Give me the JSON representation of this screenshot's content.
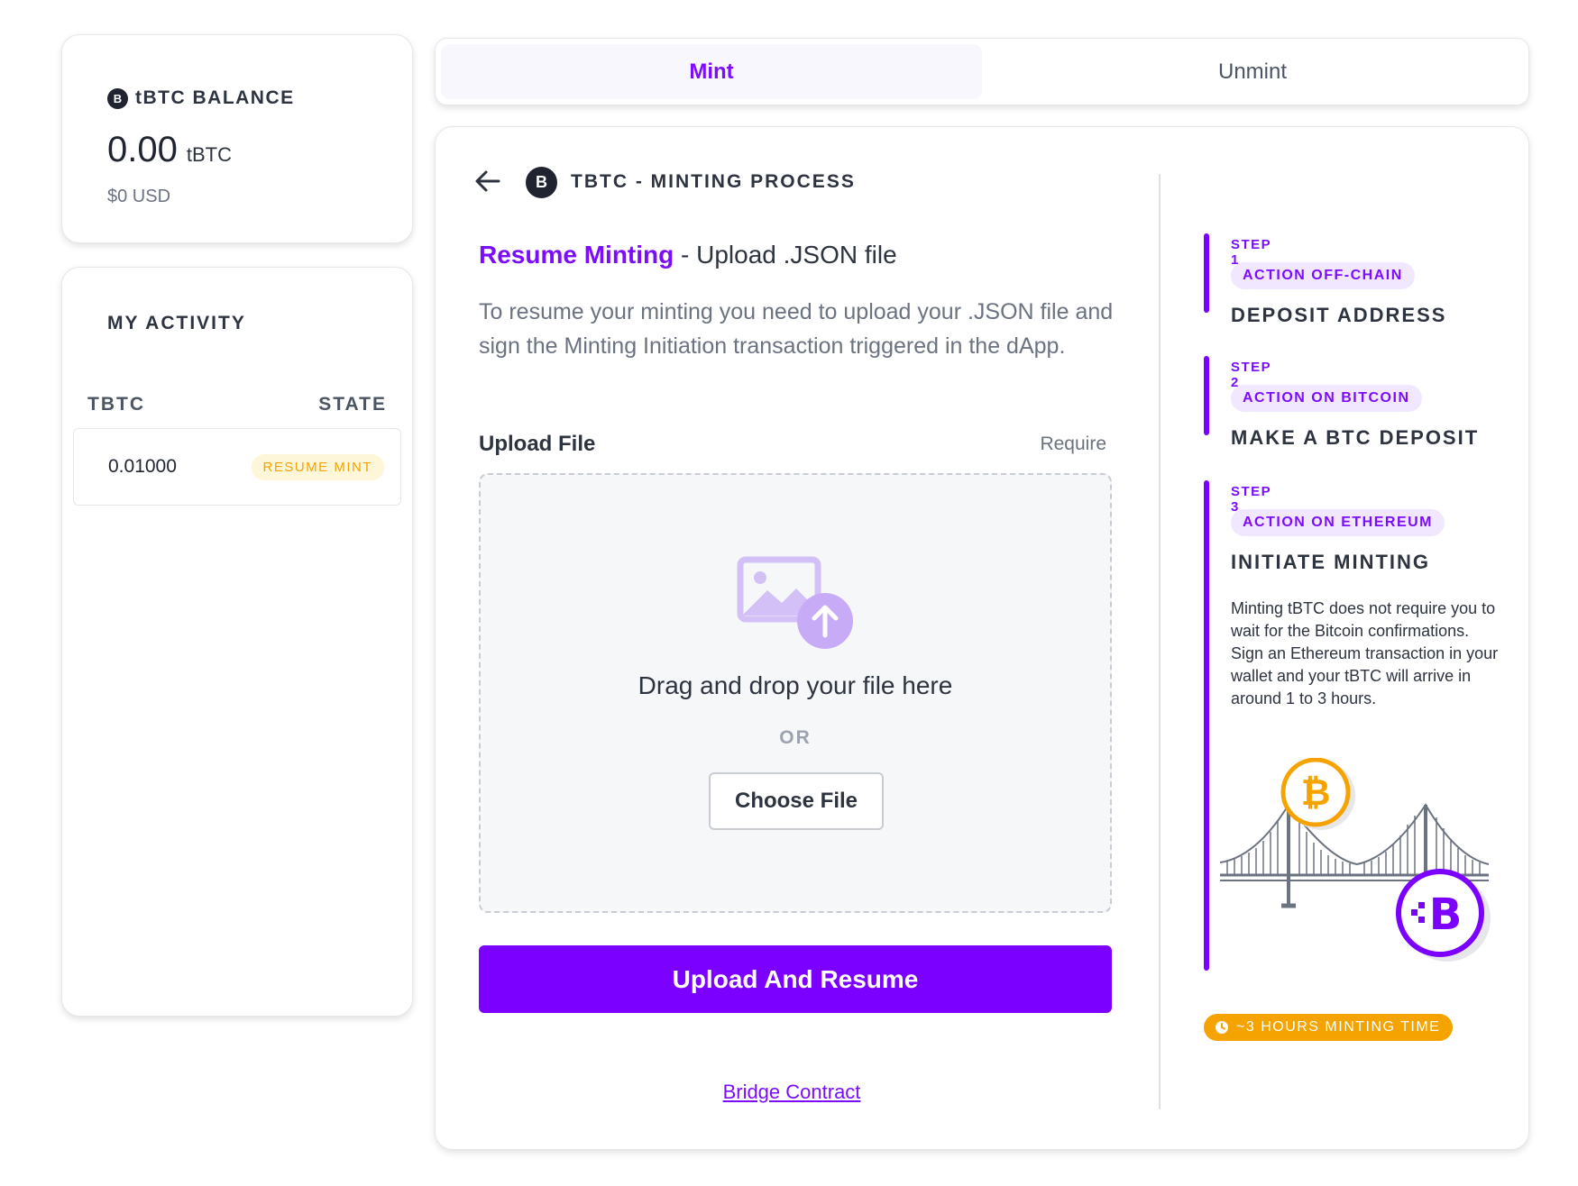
{
  "balance": {
    "title": "tBTC BALANCE",
    "amount": "0.00",
    "unit": "tBTC",
    "usd": "$0 USD",
    "logo_glyph": "B"
  },
  "activity": {
    "title": "MY ACTIVITY",
    "col_token": "TBTC",
    "col_state": "STATE",
    "rows": [
      {
        "amount": "0.01000",
        "state": "RESUME MINT"
      }
    ]
  },
  "tabs": [
    {
      "label": "Mint",
      "active": true
    },
    {
      "label": "Unmint",
      "active": false
    }
  ],
  "process": {
    "title": "TBTC - MINTING PROCESS",
    "logo_glyph": "B",
    "heading_accent": "Resume Minting",
    "heading_rest": " - Upload .JSON file",
    "description": "To resume your minting you need to upload your .JSON file and sign the Minting Initiation transaction triggered in the dApp.",
    "upload_label": "Upload File",
    "require_label": "Require",
    "drop_text": "Drag and drop your file here",
    "or_text": "OR",
    "choose_file": "Choose File",
    "submit": "Upload And Resume",
    "bridge_link": "Bridge Contract"
  },
  "steps": [
    {
      "label": "STEP 1",
      "pill": "ACTION OFF-CHAIN",
      "name": "DEPOSIT ADDRESS"
    },
    {
      "label": "STEP 2",
      "pill": "ACTION ON BITCOIN",
      "name": "MAKE A BTC DEPOSIT"
    },
    {
      "label": "STEP 3",
      "pill": "ACTION ON ETHEREUM",
      "name": "INITIATE MINTING"
    }
  ],
  "step3_desc_line1": "Minting tBTC does not require you to wait for the Bitcoin confirmations.",
  "step3_desc_line2": "Sign an Ethereum transaction in your wallet and your tBTC will arrive in around 1 to 3 hours.",
  "time_badge": "~3 HOURS MINTING TIME",
  "colors": {
    "accent": "#7b00ff",
    "warning": "#f5a300",
    "text": "#2d3440"
  },
  "icons": [
    "back-arrow-icon",
    "tbtc-logo-icon",
    "upload-image-icon",
    "bitcoin-coin-icon",
    "tbtc-coin-icon",
    "bridge-icon",
    "clock-icon"
  ]
}
